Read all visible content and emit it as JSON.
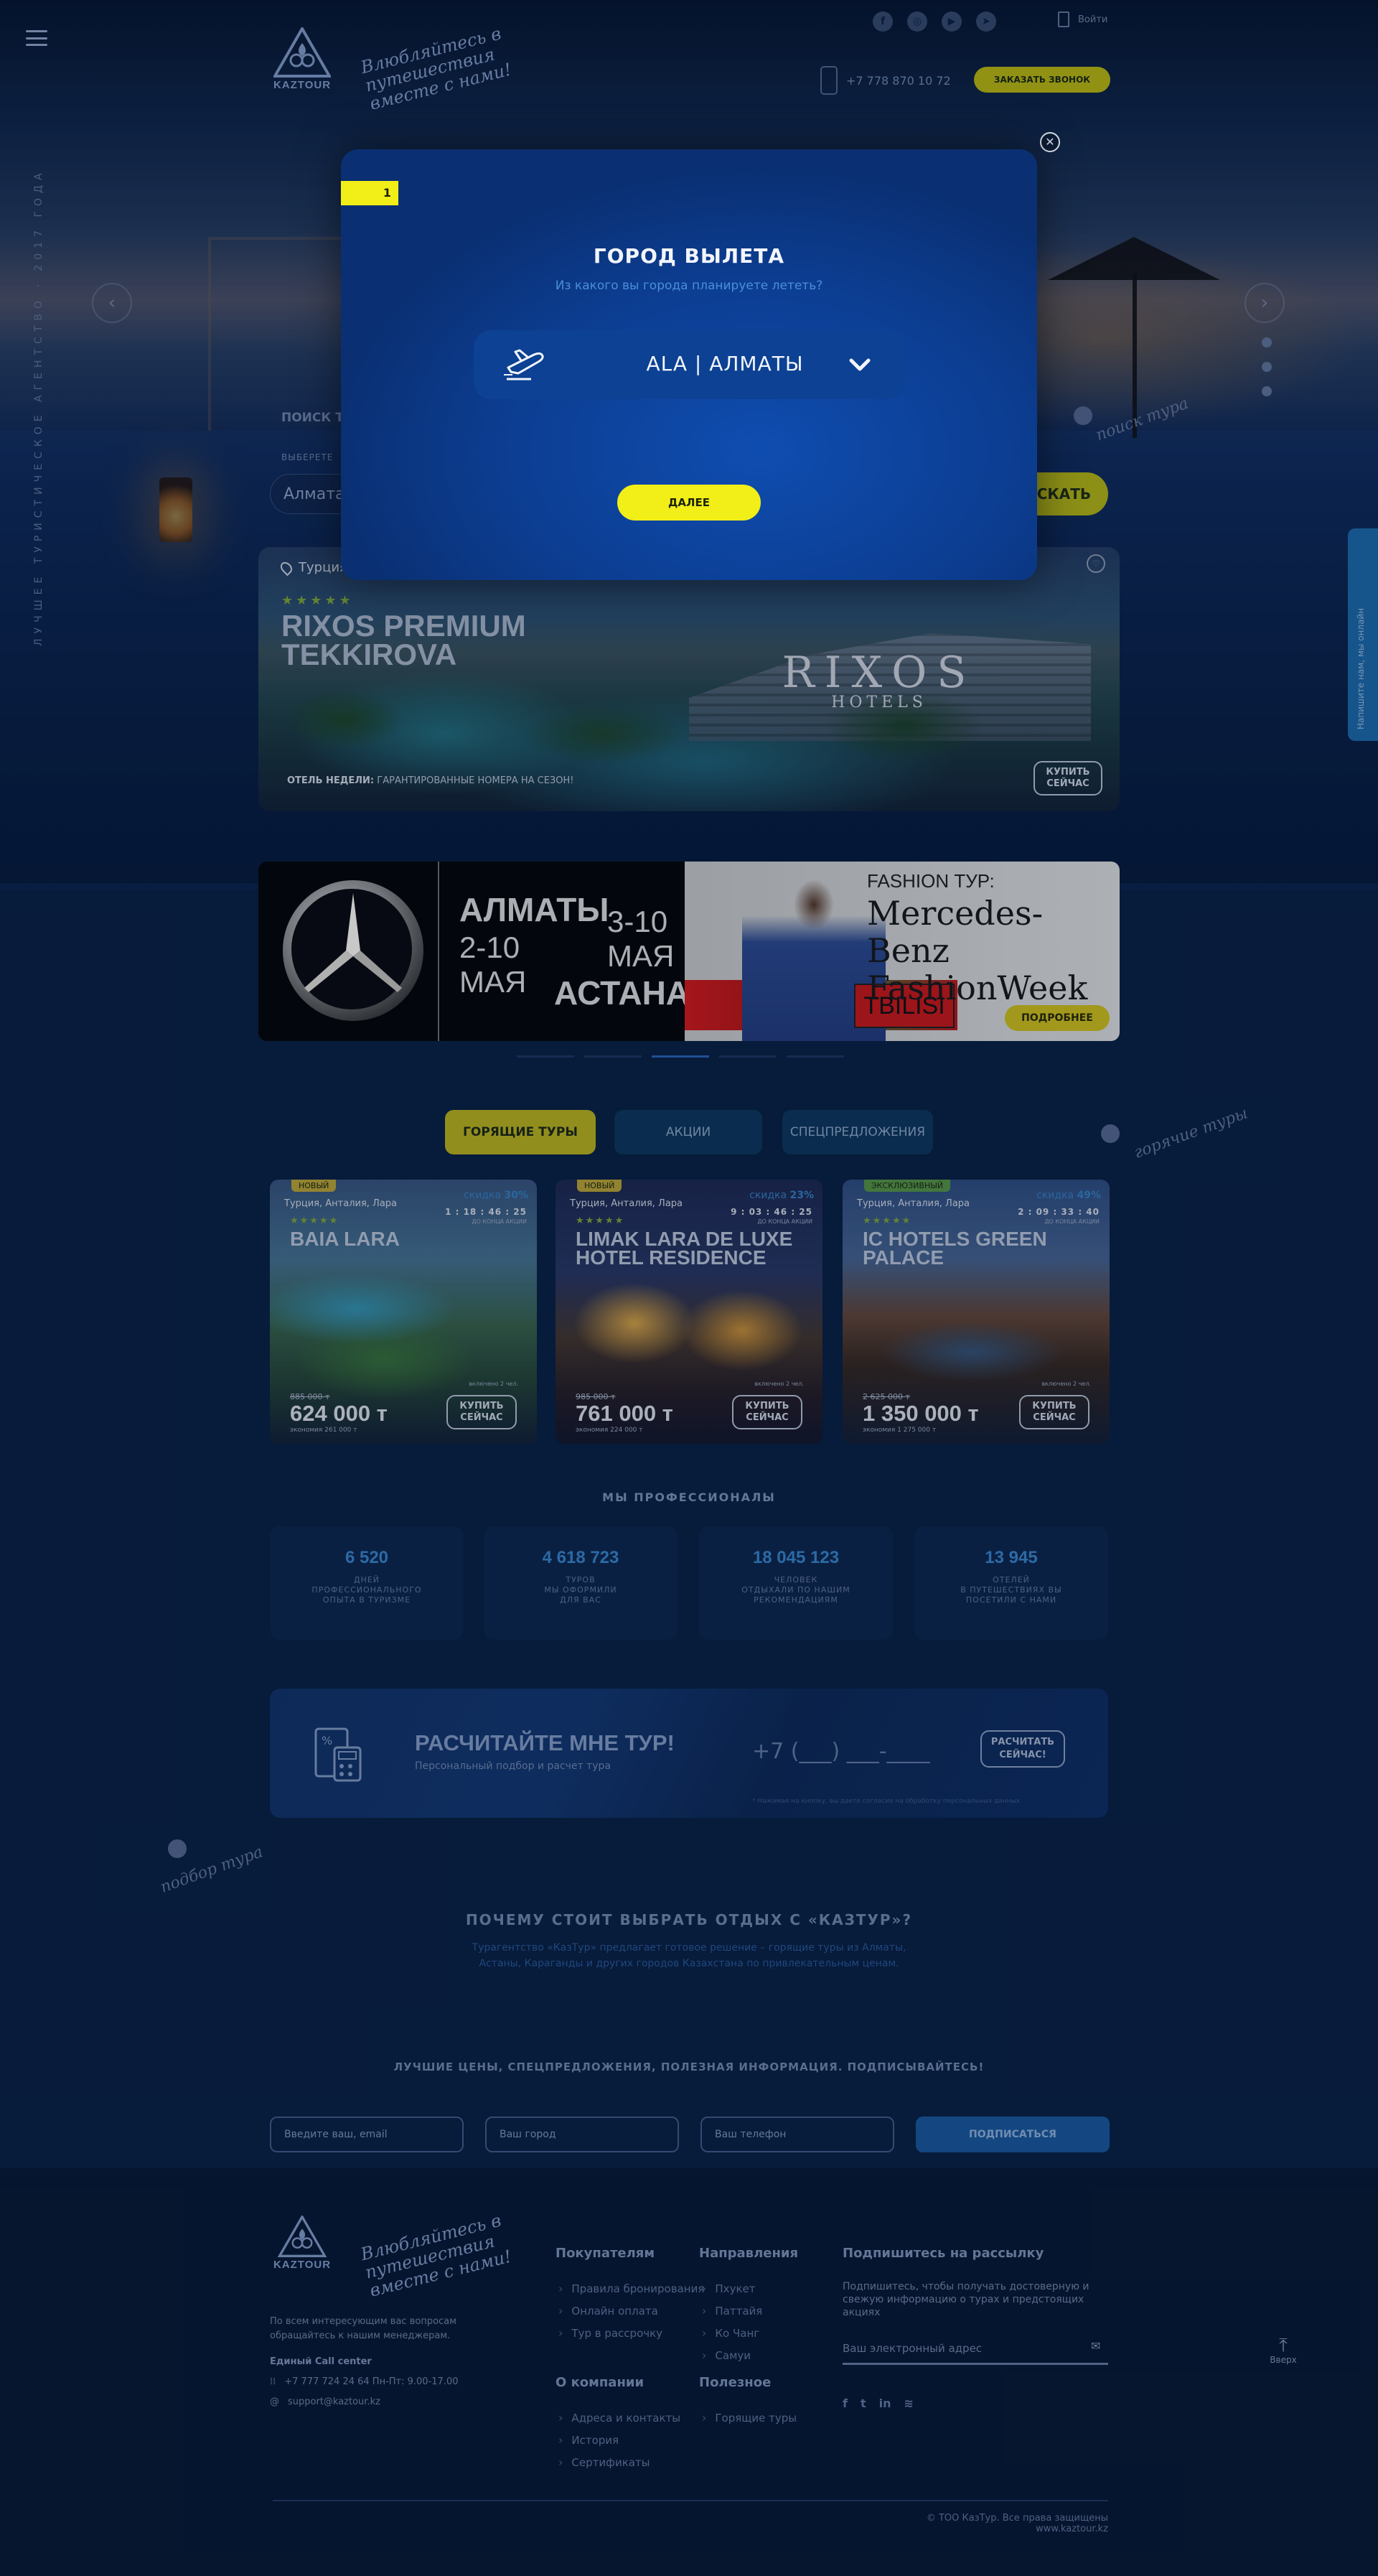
{
  "header": {
    "logo_text": "KAZTOUR",
    "slogan": "Влюбляйтесь в путешествия вместе с нами!",
    "login_label": "Войти",
    "phone": "+7 778 870 10 72",
    "call_button": "ЗАКАЗАТЬ ЗВОНОК",
    "social_icons": [
      "facebook-icon",
      "instagram-icon",
      "youtube-icon",
      "telegram-icon"
    ]
  },
  "hero": {
    "vertical_text": "ЛУЧШЕЕ ТУРИСТИЧЕСКОЕ АГЕНТСТВО · 2017 ГОДА",
    "search_title": "ПОИСК ТУРА",
    "search_sub": "ВЫБЕРЕТЕ",
    "search_value": "Алмата",
    "search_button": "ИСКАТЬ",
    "hand_label": "поиск тура",
    "side_tab": "Напишите нам, мы онлайн"
  },
  "hotel": {
    "location": "Турция, Анталия, Кемер",
    "stars": "★★★★★",
    "name_line1": "RIXOS PREMIUM",
    "name_line2": "TEKKIROVA",
    "brand": "RIXOS",
    "brand_sub": "HOTELS",
    "week_bold": "ОТЕЛЬ НЕДЕЛИ:",
    "week_text": "ГАРАНТИРОВАННЫЕ НОМЕРА НА СЕЗОН!",
    "buy_line1": "КУПИТЬ",
    "buy_line2": "СЕЙЧАС"
  },
  "mb_banner": {
    "city1": "АЛМАТЫ",
    "dates1": "2-10",
    "month1": "МАЯ",
    "dates2": "3-10",
    "month2": "МАЯ",
    "city2": "АСТАНА",
    "fashion_label": "FASHION ТУР:",
    "fashion_line1": "Mercedes-Benz",
    "fashion_line2": "FashionWeek",
    "tbilisi": "TBILISI",
    "more_button": "ПОДРОБНЕЕ"
  },
  "tabs": [
    {
      "label": "ГОРЯЩИЕ ТУРЫ"
    },
    {
      "label": "АКЦИИ"
    },
    {
      "label": "СПЕЦПРЕДЛОЖЕНИЯ"
    }
  ],
  "hot_label": "горячие туры",
  "cards": [
    {
      "badge": "НОВЫЙ",
      "location": "Турция, Анталия, Лара",
      "stars": "★★★★★",
      "name": "BAIA LARA",
      "discount_label": "скидка",
      "discount": "30%",
      "timer": "1 : 18 : 46 : 25",
      "timer_label": "ДО КОНЦА АКЦИИ",
      "includes": "включено 2 чел.",
      "old_price": "885 000 т",
      "price": "624 000 т",
      "economy": "экономия 261 000 т",
      "buy1": "КУПИТЬ",
      "buy2": "СЕЙЧАС"
    },
    {
      "badge": "НОВЫЙ",
      "location": "Турция, Анталия, Лара",
      "stars": "★★★★★",
      "name": "LIMAK LARA DE LUXE HOTEL RESIDENCE",
      "discount_label": "скидка",
      "discount": "23%",
      "timer": "9 : 03 : 46 : 25",
      "timer_label": "ДО КОНЦА АКЦИИ",
      "includes": "включено 2 чел.",
      "old_price": "985 000 т",
      "price": "761 000 т",
      "economy": "экономия 224 000 т",
      "buy1": "КУПИТЬ",
      "buy2": "СЕЙЧАС"
    },
    {
      "badge": "ЭКСКЛЮЗИВНЫЙ",
      "location": "Турция, Анталия, Лара",
      "stars": "★★★★★",
      "name": "IC HOTELS GREEN PALACE",
      "discount_label": "скидка",
      "discount": "49%",
      "timer": "2 : 09 : 33 : 40",
      "timer_label": "ДО КОНЦА АКЦИИ",
      "includes": "включено 2 чел.",
      "old_price": "2 625 000 т",
      "price": "1 350 000 т",
      "economy": "экономия 1 275 000 т",
      "buy1": "КУПИТЬ",
      "buy2": "СЕЙЧАС"
    }
  ],
  "pros": {
    "title": "МЫ ПРОФЕССИОНАЛЫ",
    "items": [
      {
        "num": "6 520",
        "l1": "ДНЕЙ",
        "l2": "ПРОФЕССИОНАЛЬНОГО",
        "l3": "ОПЫТА В ТУРИЗМЕ"
      },
      {
        "num": "4 618 723",
        "l1": "ТУРОВ",
        "l2": "МЫ ОФОРМИЛИ",
        "l3": "ДЛЯ ВАС"
      },
      {
        "num": "18 045 123",
        "l1": "ЧЕЛОВЕК",
        "l2": "ОТДЫХАЛИ ПО НАШИМ",
        "l3": "РЕКОМЕНДАЦИЯМ"
      },
      {
        "num": "13 945",
        "l1": "ОТЕЛЕЙ",
        "l2": "В ПУТЕШЕСТВИЯХ ВЫ",
        "l3": "ПОСЕТИЛИ С НАМИ"
      }
    ]
  },
  "calc": {
    "title": "РАСЧИТАЙТЕ МНЕ ТУР!",
    "subtitle": "Персональный подбор и расчет тура",
    "phone_placeholder": "+7 (___) ___-____",
    "btn1": "РАСЧИТАТЬ",
    "btn2": "СЕЙЧАС!",
    "note": "* Нажимая на кнопку, вы даете согласие на обработку персональных данных",
    "hand_label": "подбор тура"
  },
  "why": {
    "title": "ПОЧЕМУ СТОИТ ВЫБРАТЬ ОТДЫХ С «КАЗТУР»?",
    "line1": "Турагентство «КазТур» предлагает готовое решение – горящие туры из Алматы,",
    "line2": "Астаны, Караганды и других городов Казахстана по привлекательным ценам."
  },
  "subscribe": {
    "title": "ЛУЧШИЕ ЦЕНЫ, СПЕЦПРЕДЛОЖЕНИЯ, ПОЛЕЗНАЯ ИНФОРМАЦИЯ. ПОДПИСЫВАЙТЕСЬ!",
    "email_placeholder": "Введите ваш, email",
    "city_placeholder": "Ваш город",
    "phone_placeholder": "Ваш телефон",
    "button": "ПОДПИСАТЬСЯ"
  },
  "footer": {
    "logo_text": "KAZTOUR",
    "slogan": "Влюбляйтесь в путешествия вместе с нами!",
    "about1": "По всем интересующим вас вопросам",
    "about2": "обращайтесь к нашим менеджерам.",
    "callcenter_title": "Единый Call center",
    "phone_line": "+7 777 724 24 64  Пн-Пт: 9.00-17.00",
    "email": "support@kaztour.kz",
    "col_buyers": "Покупателям",
    "buyers": [
      "Правила бронирования",
      "Онлайн оплата",
      "Тур в рассрочку"
    ],
    "col_directions": "Направления",
    "directions": [
      "Пхукет",
      "Паттайя",
      "Ко Чанг",
      "Самуи"
    ],
    "col_company": "О компании",
    "company": [
      "Адреса и контакты",
      "История",
      "Сертификаты"
    ],
    "col_useful": "Полезное",
    "useful": [
      "Горящие туры"
    ],
    "newsletter_title": "Подпишитесь на рассылку",
    "newsletter_text1": "Подпишитесь, чтобы получать достоверную и",
    "newsletter_text2": "свежую информацию о турах и предстоящих",
    "newsletter_text3": "акциях",
    "newsletter_placeholder": "Ваш электронный адрес",
    "up_label": "Вверх",
    "copyright": "© ТОО КазТур. Все права защищены www.kaztour.kz"
  },
  "modal": {
    "step": "1",
    "title": "ГОРОД ВЫЛЕТА",
    "subtitle": "Из какого вы города планируете лететь?",
    "selected_city": "ALA  |  АЛМАТЫ",
    "next_button": "ДАЛЕЕ"
  },
  "colors": {
    "accent_yellow": "#f2ee17",
    "brand_blue": "#0c3d91",
    "page_bg": "#0b2246"
  }
}
